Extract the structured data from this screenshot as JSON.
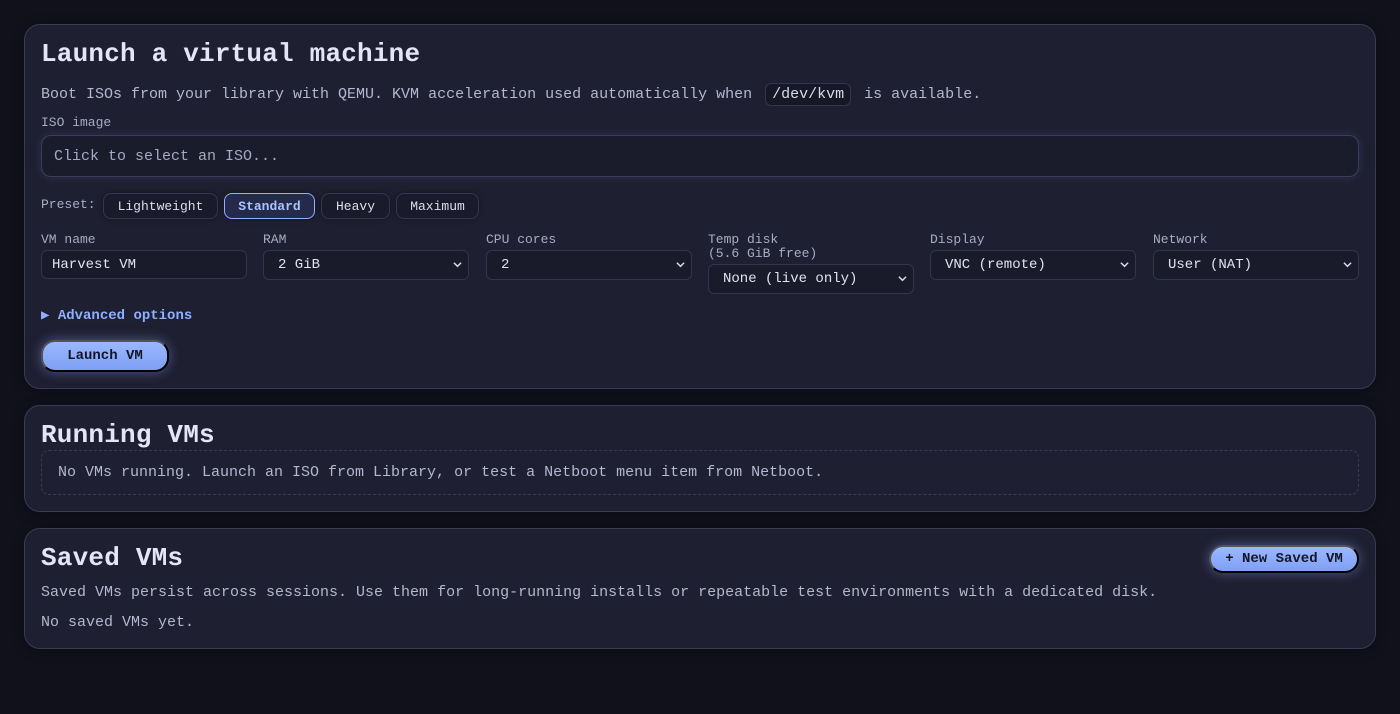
{
  "launch": {
    "title": "Launch a virtual machine",
    "description_before": "Boot ISOs from your library with QEMU. KVM acceleration used automatically when",
    "description_code": "/dev/kvm",
    "description_after": "is available.",
    "iso_label": "ISO image",
    "iso_placeholder": "Click to select an ISO...",
    "preset_label": "Preset:",
    "presets": [
      {
        "label": "Lightweight",
        "active": false
      },
      {
        "label": "Standard",
        "active": true
      },
      {
        "label": "Heavy",
        "active": false
      },
      {
        "label": "Maximum",
        "active": false
      }
    ],
    "fields": {
      "vm_name": {
        "label": "VM name",
        "value": "Harvest VM"
      },
      "ram": {
        "label": "RAM",
        "value": "2 GiB"
      },
      "cpu": {
        "label": "CPU cores",
        "value": "2"
      },
      "temp_disk": {
        "label": "Temp disk",
        "sublabel": "(5.6 GiB free)",
        "value": "None (live only)"
      },
      "display": {
        "label": "Display",
        "value": "VNC (remote)"
      },
      "network": {
        "label": "Network",
        "value": "User (NAT)"
      }
    },
    "advanced_label": "▶ Advanced options",
    "launch_button": "Launch VM"
  },
  "running": {
    "title": "Running VMs",
    "empty_text": "No VMs running. Launch an ISO from Library, or test a Netboot menu item from Netboot."
  },
  "saved": {
    "title": "Saved VMs",
    "new_button": "+ New Saved VM",
    "description": "Saved VMs persist across sessions. Use them for long-running installs or repeatable test environments with a dedicated disk.",
    "empty_text": "No saved VMs yet."
  },
  "colors": {
    "background": "#10111b",
    "card": "#1e1f30",
    "accent": "#8fb0ff"
  }
}
